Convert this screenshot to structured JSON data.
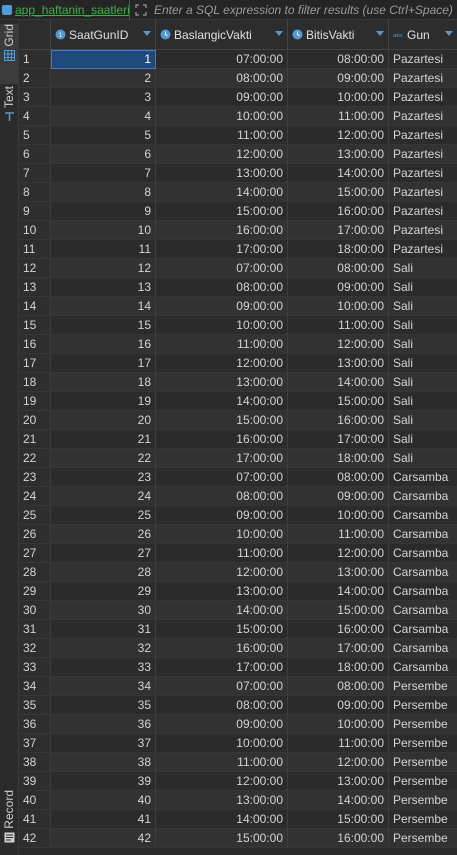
{
  "tab": {
    "title": "app_haftanin_saatleri"
  },
  "filter": {
    "placeholder": "Enter a SQL expression to filter results (use Ctrl+Space)"
  },
  "sidebar": {
    "grid_label": "Grid",
    "text_label": "Text",
    "record_label": "Record"
  },
  "colors": {
    "accent": "#4e9bd6",
    "selection": "#1d4a7a",
    "tab_title": "#3cb043"
  },
  "columns": [
    {
      "label": "SaatGunID",
      "icon": "numeric-column-icon"
    },
    {
      "label": "BaslangicVakti",
      "icon": "time-column-icon"
    },
    {
      "label": "BitisVakti",
      "icon": "time-column-icon"
    },
    {
      "label": "Gun",
      "icon": "text-column-icon"
    }
  ],
  "rows": [
    [
      "1",
      "07:00:00",
      "08:00:00",
      "Pazartesi"
    ],
    [
      "2",
      "08:00:00",
      "09:00:00",
      "Pazartesi"
    ],
    [
      "3",
      "09:00:00",
      "10:00:00",
      "Pazartesi"
    ],
    [
      "4",
      "10:00:00",
      "11:00:00",
      "Pazartesi"
    ],
    [
      "5",
      "11:00:00",
      "12:00:00",
      "Pazartesi"
    ],
    [
      "6",
      "12:00:00",
      "13:00:00",
      "Pazartesi"
    ],
    [
      "7",
      "13:00:00",
      "14:00:00",
      "Pazartesi"
    ],
    [
      "8",
      "14:00:00",
      "15:00:00",
      "Pazartesi"
    ],
    [
      "9",
      "15:00:00",
      "16:00:00",
      "Pazartesi"
    ],
    [
      "10",
      "16:00:00",
      "17:00:00",
      "Pazartesi"
    ],
    [
      "11",
      "17:00:00",
      "18:00:00",
      "Pazartesi"
    ],
    [
      "12",
      "07:00:00",
      "08:00:00",
      "Sali"
    ],
    [
      "13",
      "08:00:00",
      "09:00:00",
      "Sali"
    ],
    [
      "14",
      "09:00:00",
      "10:00:00",
      "Sali"
    ],
    [
      "15",
      "10:00:00",
      "11:00:00",
      "Sali"
    ],
    [
      "16",
      "11:00:00",
      "12:00:00",
      "Sali"
    ],
    [
      "17",
      "12:00:00",
      "13:00:00",
      "Sali"
    ],
    [
      "18",
      "13:00:00",
      "14:00:00",
      "Sali"
    ],
    [
      "19",
      "14:00:00",
      "15:00:00",
      "Sali"
    ],
    [
      "20",
      "15:00:00",
      "16:00:00",
      "Sali"
    ],
    [
      "21",
      "16:00:00",
      "17:00:00",
      "Sali"
    ],
    [
      "22",
      "17:00:00",
      "18:00:00",
      "Sali"
    ],
    [
      "23",
      "07:00:00",
      "08:00:00",
      "Carsamba"
    ],
    [
      "24",
      "08:00:00",
      "09:00:00",
      "Carsamba"
    ],
    [
      "25",
      "09:00:00",
      "10:00:00",
      "Carsamba"
    ],
    [
      "26",
      "10:00:00",
      "11:00:00",
      "Carsamba"
    ],
    [
      "27",
      "11:00:00",
      "12:00:00",
      "Carsamba"
    ],
    [
      "28",
      "12:00:00",
      "13:00:00",
      "Carsamba"
    ],
    [
      "29",
      "13:00:00",
      "14:00:00",
      "Carsamba"
    ],
    [
      "30",
      "14:00:00",
      "15:00:00",
      "Carsamba"
    ],
    [
      "31",
      "15:00:00",
      "16:00:00",
      "Carsamba"
    ],
    [
      "32",
      "16:00:00",
      "17:00:00",
      "Carsamba"
    ],
    [
      "33",
      "17:00:00",
      "18:00:00",
      "Carsamba"
    ],
    [
      "34",
      "07:00:00",
      "08:00:00",
      "Persembe"
    ],
    [
      "35",
      "08:00:00",
      "09:00:00",
      "Persembe"
    ],
    [
      "36",
      "09:00:00",
      "10:00:00",
      "Persembe"
    ],
    [
      "37",
      "10:00:00",
      "11:00:00",
      "Persembe"
    ],
    [
      "38",
      "11:00:00",
      "12:00:00",
      "Persembe"
    ],
    [
      "39",
      "12:00:00",
      "13:00:00",
      "Persembe"
    ],
    [
      "40",
      "13:00:00",
      "14:00:00",
      "Persembe"
    ],
    [
      "41",
      "14:00:00",
      "15:00:00",
      "Persembe"
    ],
    [
      "42",
      "15:00:00",
      "16:00:00",
      "Persembe"
    ]
  ]
}
